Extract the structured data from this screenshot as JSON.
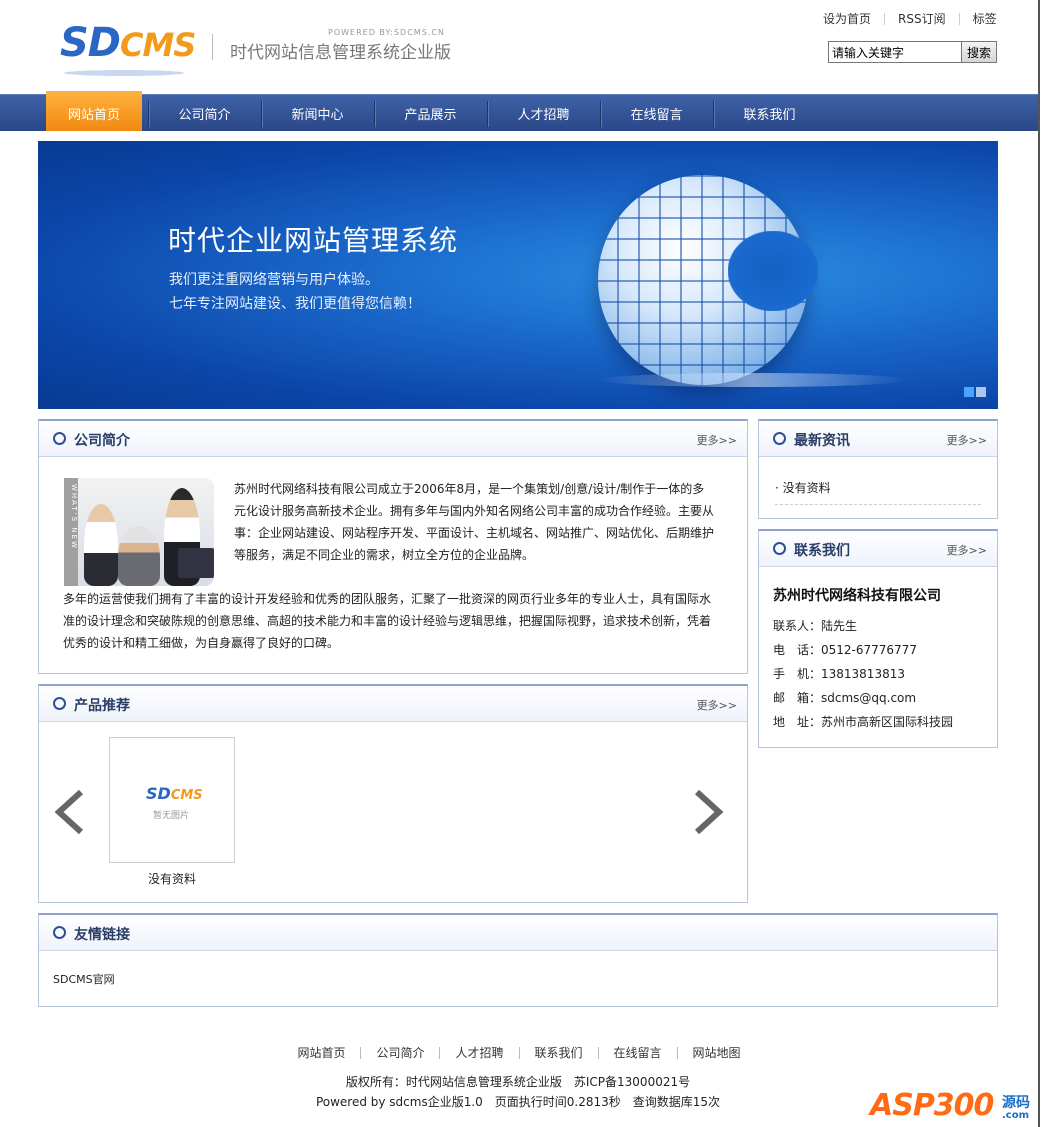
{
  "header": {
    "logo_sd": "SD",
    "logo_cms": "CMS",
    "powered": "POWERED BY:SDCMS.CN",
    "slogan": "时代网站信息管理系统企业版",
    "toplinks": [
      "设为首页",
      "RSS订阅",
      "标签"
    ],
    "search_placeholder": "请输入关键字",
    "search_value": "请输入关键字",
    "search_button": "搜索"
  },
  "nav": {
    "items": [
      "网站首页",
      "公司简介",
      "新闻中心",
      "产品展示",
      "人才招聘",
      "在线留言",
      "联系我们"
    ],
    "active_index": 0
  },
  "banner": {
    "title": "时代企业网站管理系统",
    "line1": "我们更注重网络营销与用户体验。",
    "line2": "七年专注网站建设、我们更值得您信赖！",
    "slide_count": 2,
    "current_slide": 1
  },
  "about": {
    "title": "公司简介",
    "more": "更多>>",
    "image_strip": "WHAT'S NEW",
    "p1": "苏州时代网络科技有限公司成立于2006年8月，是一个集策划/创意/设计/制作于一体的多元化设计服务高新技术企业。拥有多年与国内外知名网络公司丰富的成功合作经验。主要从事：企业网站建设、网站程序开发、平面设计、主机域名、网站推广、网站优化、后期维护等服务，满足不同企业的需求，树立全方位的企业品牌。",
    "p2": "多年的运营使我们拥有了丰富的设计开发经验和优秀的团队服务，汇聚了一批资深的网页行业多年的专业人士，具有国际水准的设计理念和突破陈规的创意思维、高超的技术能力和丰富的设计经验与逻辑思维，把握国际视野，追求技术创新，凭着优秀的设计和精工细做，为自身赢得了良好的口碑。"
  },
  "news": {
    "title": "最新资讯",
    "more": "更多>>",
    "item": "· 没有资料"
  },
  "contact": {
    "title": "联系我们",
    "more": "更多>>",
    "company": "苏州时代网络科技有限公司",
    "person": "联系人：陆先生",
    "phone": "电　话：0512-67776777",
    "mobile": "手　机：13813813813",
    "email": "邮　箱：sdcms@qq.com",
    "address": "地　址：苏州市高新区国际科技园"
  },
  "products": {
    "title": "产品推荐",
    "more": "更多>>",
    "placeholder_logo_sd": "SD",
    "placeholder_logo_cms": "CMS",
    "placeholder_text": "暂无图片",
    "item_label": "没有资料"
  },
  "links": {
    "title": "友情链接",
    "item": "SDCMS官网"
  },
  "footer": {
    "nav": [
      "网站首页",
      "公司简介",
      "人才招聘",
      "联系我们",
      "在线留言",
      "网站地图"
    ],
    "copyright": "版权所有：时代网站信息管理系统企业版　苏ICP备13000021号",
    "powered": "Powered by sdcms企业版1.0　页面执行时间0.2813秒　查询数据库15次"
  },
  "watermark": {
    "asp": "ASP300",
    "code": "源码",
    "com": ".com"
  },
  "colors": {
    "nav_bg": "#2f4f94",
    "nav_active": "#f8a02a",
    "accent_blue": "#2a66c4",
    "logo_orange": "#f39a1a"
  }
}
